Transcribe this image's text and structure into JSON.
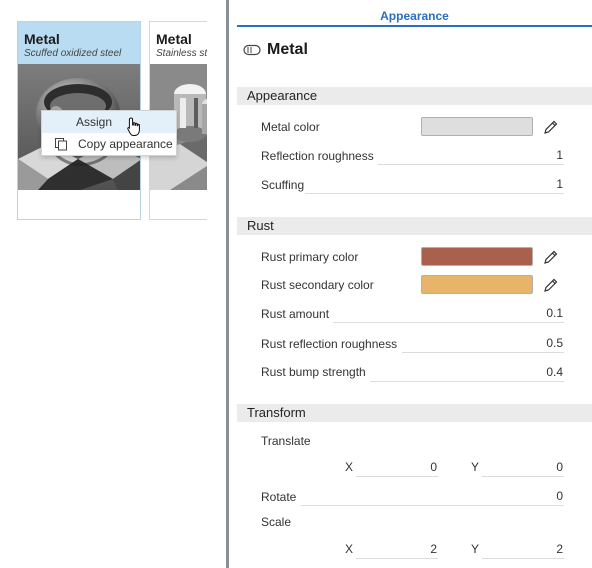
{
  "library": {
    "cards": [
      {
        "title": "Metal",
        "subtitle": "Scuffed oxidized steel"
      },
      {
        "title": "Metal",
        "subtitle": "Stainless st"
      }
    ]
  },
  "context_menu": {
    "items": [
      {
        "label": "Assign",
        "icon": "cursor-hand-icon"
      },
      {
        "label": "Copy appearance",
        "icon": "copy-icon"
      }
    ]
  },
  "panel": {
    "tab": "Appearance",
    "material_icon": "metal-material-icon",
    "material_title": "Metal",
    "sections": {
      "appearance": {
        "title": "Appearance",
        "metal_color_label": "Metal color",
        "metal_color": "#dedede",
        "reflection_roughness_label": "Reflection roughness",
        "reflection_roughness": "1",
        "scuffing_label": "Scuffing",
        "scuffing": "1"
      },
      "rust": {
        "title": "Rust",
        "primary_label": "Rust primary color",
        "primary_color": "#a9614e",
        "secondary_label": "Rust secondary color",
        "secondary_color": "#e7b46a",
        "amount_label": "Rust amount",
        "amount": "0.1",
        "reflection_roughness_label": "Rust reflection roughness",
        "reflection_roughness": "0.5",
        "bump_strength_label": "Rust bump strength",
        "bump_strength": "0.4"
      },
      "transform": {
        "title": "Transform",
        "translate_label": "Translate",
        "translate_x_label": "X",
        "translate_x": "0",
        "translate_y_label": "Y",
        "translate_y": "0",
        "rotate_label": "Rotate",
        "rotate": "0",
        "scale_label": "Scale",
        "scale_x_label": "X",
        "scale_x": "2",
        "scale_y_label": "Y",
        "scale_y": "2"
      }
    }
  },
  "colors": {
    "accent": "#2a6fc0",
    "selected_card": "#b9dcf3",
    "section_bg": "#ebebeb"
  }
}
